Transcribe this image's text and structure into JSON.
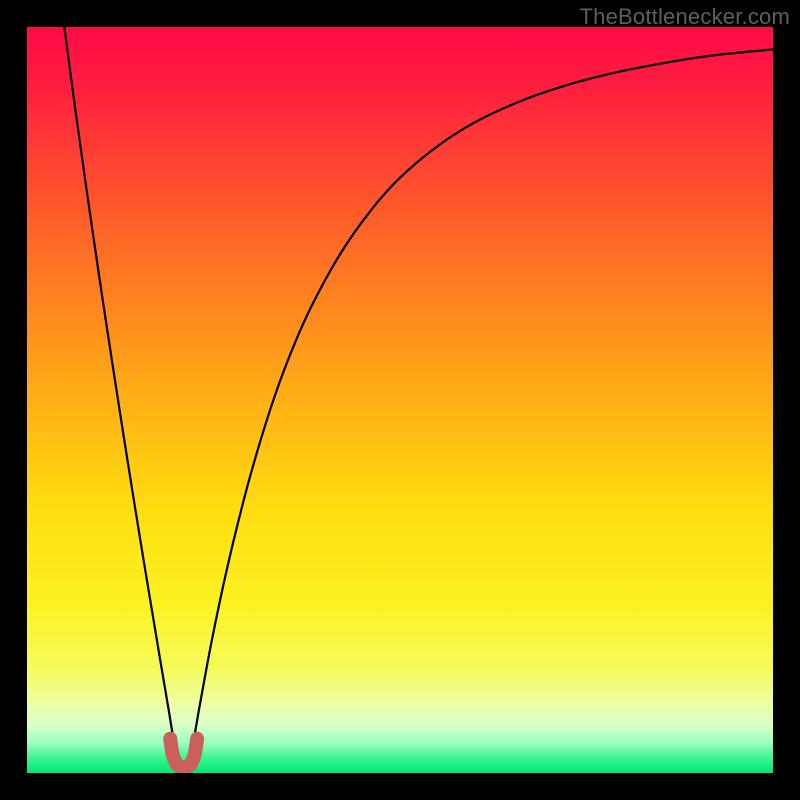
{
  "watermark": "TheBottlenecker.com",
  "chart_data": {
    "type": "line",
    "title": "",
    "xlabel": "",
    "ylabel": "",
    "xlim": [
      0,
      100
    ],
    "ylim": [
      0,
      100
    ],
    "grid": false,
    "legend": false,
    "gradient_stops": [
      {
        "offset": 0.0,
        "color": "#ff0b46"
      },
      {
        "offset": 0.08,
        "color": "#ff1e3f"
      },
      {
        "offset": 0.2,
        "color": "#ff4a2f"
      },
      {
        "offset": 0.35,
        "color": "#ff7e20"
      },
      {
        "offset": 0.5,
        "color": "#ffb015"
      },
      {
        "offset": 0.65,
        "color": "#ffde10"
      },
      {
        "offset": 0.78,
        "color": "#fbf324"
      },
      {
        "offset": 0.86,
        "color": "#f6fb5c"
      },
      {
        "offset": 0.905,
        "color": "#eeffa0"
      },
      {
        "offset": 0.935,
        "color": "#d9ffc8"
      },
      {
        "offset": 0.96,
        "color": "#9cffc0"
      },
      {
        "offset": 0.98,
        "color": "#39f68e"
      },
      {
        "offset": 1.0,
        "color": "#00e672"
      }
    ],
    "series": [
      {
        "name": "bottleneck-curve-left",
        "color": "#000000",
        "x": [
          5.0,
          6.0,
          7.0,
          8.0,
          9.0,
          10.0,
          11.0,
          12.0,
          13.0,
          14.0,
          15.0,
          16.0,
          17.0,
          18.0,
          19.0,
          19.7
        ],
        "y": [
          100.0,
          92.5,
          85.2,
          78.1,
          71.2,
          64.4,
          57.8,
          51.3,
          44.9,
          38.6,
          32.4,
          26.3,
          20.3,
          14.3,
          8.4,
          4.1
        ]
      },
      {
        "name": "bottleneck-curve-right",
        "color": "#000000",
        "x": [
          22.3,
          23.0,
          24.0,
          25.0,
          26.5,
          28.0,
          30.0,
          32.5,
          35.0,
          38.0,
          42.0,
          46.0,
          50.0,
          55.0,
          60.0,
          66.0,
          72.0,
          78.0,
          85.0,
          92.0,
          100.0
        ],
        "y": [
          4.1,
          8.2,
          13.7,
          18.9,
          26.0,
          32.4,
          40.1,
          48.4,
          55.4,
          62.3,
          69.6,
          75.3,
          79.8,
          84.0,
          87.2,
          90.0,
          92.1,
          93.7,
          95.1,
          96.2,
          97.0
        ]
      },
      {
        "name": "optimal-marker",
        "color": "#cb5f5c",
        "x": [
          19.2,
          19.5,
          20.0,
          20.5,
          21.0,
          21.5,
          22.0,
          22.5,
          22.8
        ],
        "y": [
          4.6,
          2.6,
          1.3,
          0.9,
          0.8,
          0.9,
          1.3,
          2.6,
          4.6
        ]
      }
    ]
  }
}
